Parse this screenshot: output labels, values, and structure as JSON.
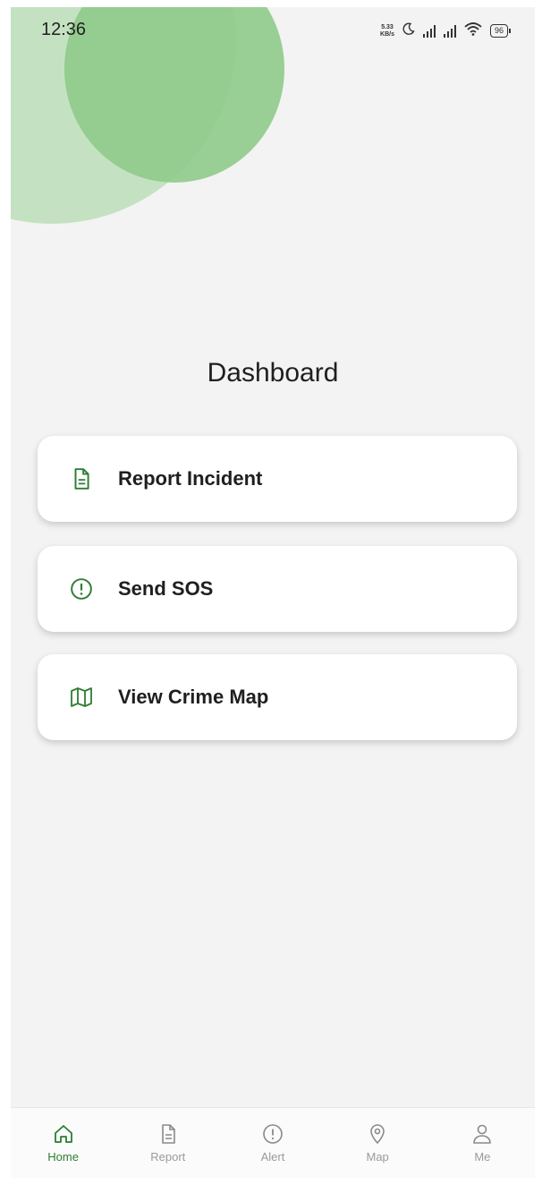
{
  "status": {
    "time": "12:36",
    "net_speed_value": "5.33",
    "net_speed_unit": "KB/s",
    "battery": "96"
  },
  "page": {
    "title": "Dashboard"
  },
  "actions": [
    {
      "label": "Report Incident",
      "icon": "document-icon"
    },
    {
      "label": "Send SOS",
      "icon": "alert-circle-icon"
    },
    {
      "label": "View Crime Map",
      "icon": "map-icon"
    }
  ],
  "nav": [
    {
      "label": "Home",
      "icon": "home-icon",
      "active": true
    },
    {
      "label": "Report",
      "icon": "document-icon",
      "active": false
    },
    {
      "label": "Alert",
      "icon": "alert-circle-icon",
      "active": false
    },
    {
      "label": "Map",
      "icon": "location-pin-icon",
      "active": false
    },
    {
      "label": "Me",
      "icon": "person-icon",
      "active": false
    }
  ],
  "colors": {
    "accent": "#2e7d32",
    "blob_light": "#c4e2c1",
    "blob_dark": "#8fcb8a",
    "background": "#f3f3f3"
  }
}
